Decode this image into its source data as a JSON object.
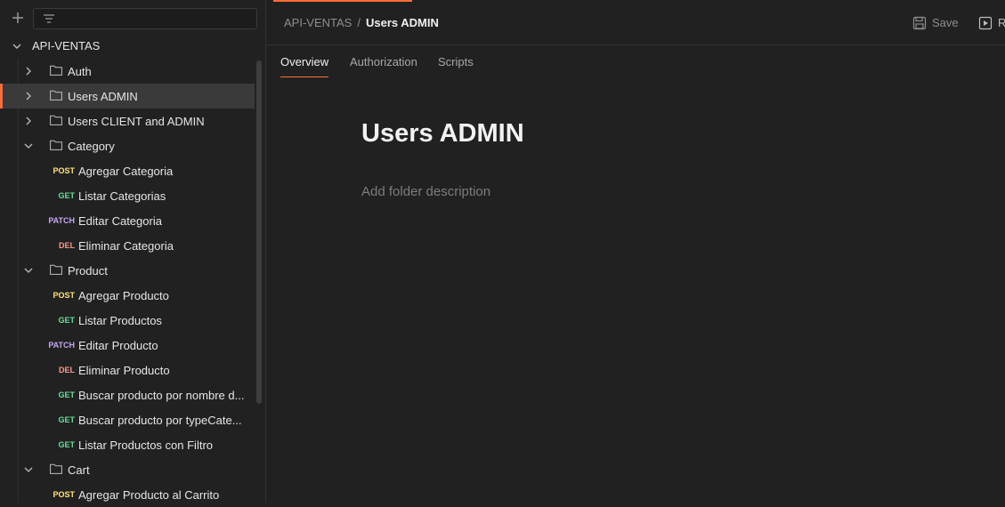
{
  "colors": {
    "accent": "#ff6c37",
    "post": "#ffe47e",
    "get": "#6bdd9a",
    "patch": "#c4a7f3",
    "del": "#f79a8e"
  },
  "sidebar": {
    "collection_name": "API-VENTAS",
    "items": [
      {
        "kind": "folder",
        "label": "Auth",
        "expanded": false,
        "selected": false
      },
      {
        "kind": "folder",
        "label": "Users ADMIN",
        "expanded": false,
        "selected": true
      },
      {
        "kind": "folder",
        "label": "Users CLIENT and ADMIN",
        "expanded": false,
        "selected": false
      },
      {
        "kind": "folder",
        "label": "Category",
        "expanded": true,
        "selected": false
      },
      {
        "kind": "request",
        "method": "POST",
        "label": "Agregar Categoria"
      },
      {
        "kind": "request",
        "method": "GET",
        "label": "Listar Categorias"
      },
      {
        "kind": "request",
        "method": "PATCH",
        "label": "Editar Categoria"
      },
      {
        "kind": "request",
        "method": "DEL",
        "label": "Eliminar Categoria"
      },
      {
        "kind": "folder",
        "label": "Product",
        "expanded": true,
        "selected": false
      },
      {
        "kind": "request",
        "method": "POST",
        "label": "Agregar Producto"
      },
      {
        "kind": "request",
        "method": "GET",
        "label": "Listar Productos"
      },
      {
        "kind": "request",
        "method": "PATCH",
        "label": "Editar Producto"
      },
      {
        "kind": "request",
        "method": "DEL",
        "label": "Eliminar Producto"
      },
      {
        "kind": "request",
        "method": "GET",
        "label": "Buscar producto por nombre d..."
      },
      {
        "kind": "request",
        "method": "GET",
        "label": "Buscar producto por typeCate..."
      },
      {
        "kind": "request",
        "method": "GET",
        "label": "Listar Productos con Filtro"
      },
      {
        "kind": "folder",
        "label": "Cart",
        "expanded": true,
        "selected": false
      },
      {
        "kind": "request",
        "method": "POST",
        "label": "Agregar Producto al Carrito"
      }
    ]
  },
  "header": {
    "breadcrumb_parent": "API-VENTAS",
    "breadcrumb_separator": "/",
    "breadcrumb_current": "Users ADMIN",
    "save_label": "Save",
    "run_label": "R"
  },
  "tabs": [
    {
      "label": "Overview",
      "active": true
    },
    {
      "label": "Authorization",
      "active": false
    },
    {
      "label": "Scripts",
      "active": false
    }
  ],
  "overview": {
    "title": "Users ADMIN",
    "description_placeholder": "Add folder description"
  }
}
